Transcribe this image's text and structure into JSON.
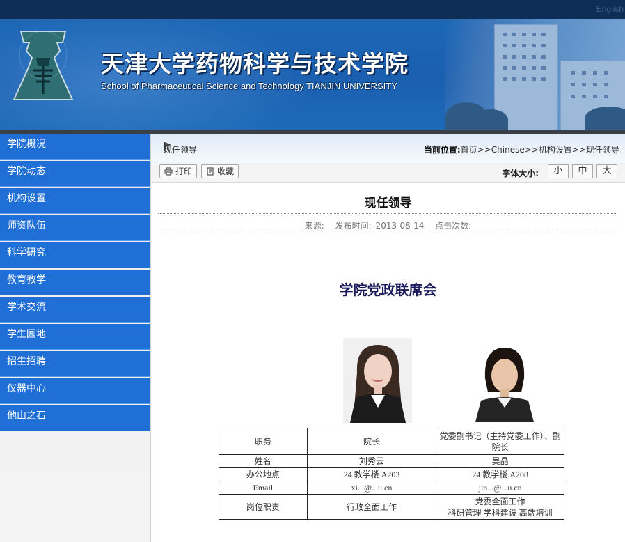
{
  "header": {
    "english_link": "English",
    "title_cn": "天津大学药物科学与技术学院",
    "title_en": "School of Pharmaceutical Science and Technology TIANJIN UNIVERSITY"
  },
  "sidebar": {
    "items": [
      {
        "label": "学院概况"
      },
      {
        "label": "学院动态"
      },
      {
        "label": "机构设置"
      },
      {
        "label": "师资队伍"
      },
      {
        "label": "科学研究"
      },
      {
        "label": "教育教学"
      },
      {
        "label": "学术交流"
      },
      {
        "label": "学生园地"
      },
      {
        "label": "招生招聘"
      },
      {
        "label": "仪器中心"
      },
      {
        "label": "他山之石"
      }
    ]
  },
  "breadcrumb": {
    "page_title": "现任领导",
    "location_label": "当前位置:",
    "path": [
      "首页",
      "Chinese",
      "机构设置",
      "现任领导"
    ],
    "separator": ">>"
  },
  "toolbar": {
    "print_label": "打印",
    "favorite_label": "收藏",
    "font_size_label": "字体大小:",
    "font_sizes": [
      "小",
      "中",
      "大"
    ]
  },
  "article": {
    "title": "现任领导",
    "source_label": "来源:",
    "publish_label": "发布时间:",
    "publish_date": "2013-08-14",
    "clicks_label": "点击次数:",
    "section_title": "学院党政联席会"
  },
  "leaders_table": {
    "rows": [
      {
        "label": "职务",
        "a": "院长",
        "b": "党委副书记（主持党委工作）、副院长"
      },
      {
        "label": "姓名",
        "a": "刘秀云",
        "b": "吴晶"
      },
      {
        "label": "办公地点",
        "a": "24 教学楼 A203",
        "b": "24 教学楼 A208"
      },
      {
        "label": "Email",
        "a": "xi...@...u.cn",
        "b": "jin...@...u.cn"
      },
      {
        "label": "岗位职责",
        "a": "行政全面工作",
        "b": "党委全面工作\n科研管理  学科建设  高端培训"
      }
    ]
  },
  "colors": {
    "top_bar": "#0e2d57",
    "banner_blue": "#1b5fb0",
    "nav_blue": "#1f6fd6",
    "section_title": "#1a1a5a"
  },
  "icons": {
    "print": "printer-icon",
    "favorite": "bookmark-icon",
    "crumb": "flag-icon"
  }
}
